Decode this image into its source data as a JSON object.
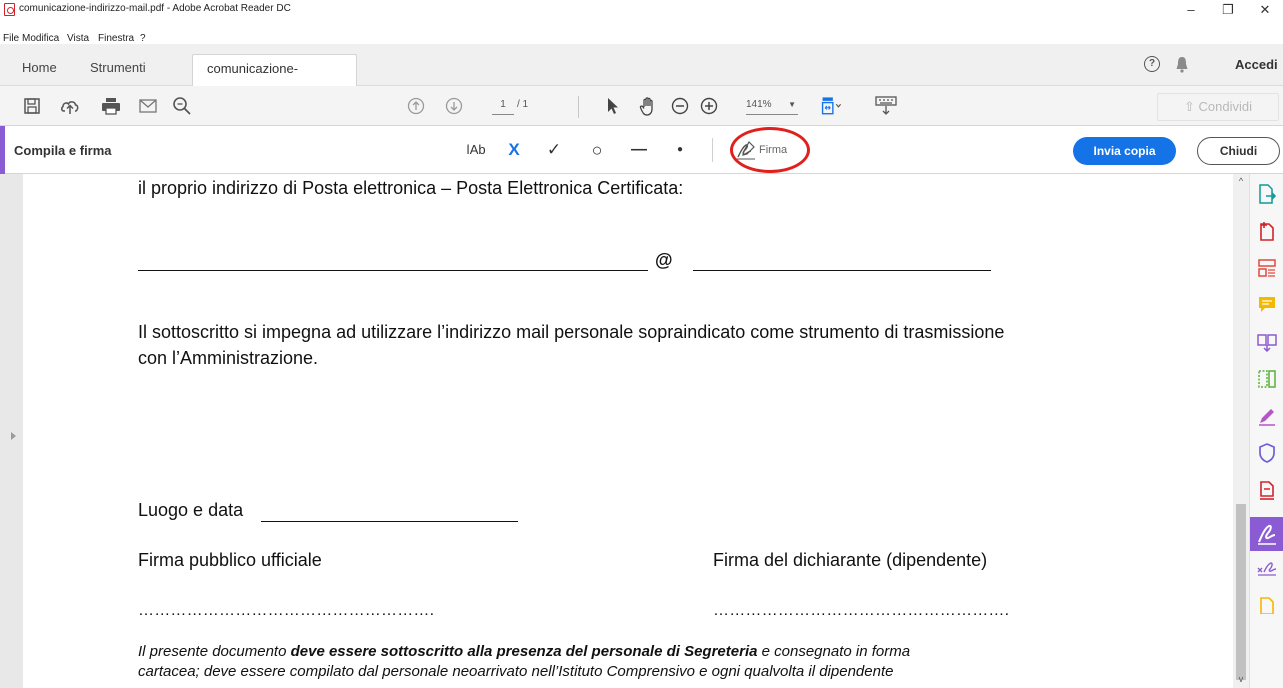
{
  "window": {
    "title": "comunicazione-indirizzo-mail.pdf - Adobe Acrobat Reader DC",
    "controls": {
      "minimize": "–",
      "restore": "❐",
      "close": "✕"
    }
  },
  "menu": [
    "File",
    "Modifica",
    "Vista",
    "Finestra",
    "?"
  ],
  "tabs": {
    "home": "Home",
    "tools": "Strumenti",
    "document": "comunicazione-indi...",
    "document_close": "×",
    "help_icon": "?",
    "signin": "Accedi"
  },
  "toolbar": {
    "page_current": "1",
    "page_total": "/ 1",
    "zoom": "141%",
    "zoom_dropdown": "▼",
    "share": "Condividi",
    "icons": [
      "save-icon",
      "upload-cloud-icon",
      "print-icon",
      "email-icon",
      "search-icon",
      "page-up-icon",
      "page-down-icon",
      "select-cursor-icon",
      "hand-icon",
      "zoom-out-icon",
      "zoom-in-icon",
      "fit-page-icon",
      "keyboard-icon"
    ]
  },
  "fill_sign": {
    "label": "Compila e firma",
    "text_tool": "ǀAb",
    "cross_tool": "X",
    "check_tool": "✓",
    "circle_tool": "○",
    "line_tool": "—",
    "dot_tool": "●",
    "sign_label": "Firma",
    "send_copy": "Invia copia",
    "close": "Chiudi"
  },
  "document": {
    "line1": "il proprio indirizzo di Posta elettronica – Posta Elettronica Certificata:",
    "at_sign": "@",
    "para1_l1": "Il sottoscritto si impegna ad utilizzare l’indirizzo mail personale sopraindicato come strumento di trasmissione",
    "para1_l2": "con  l’Amministrazione.",
    "place_date": "Luogo e data",
    "sig_official": "Firma pubblico ufficiale",
    "sig_declarant": "Firma del dichiarante (dipendente)",
    "dots_left": "……………………………………………….",
    "dots_right": "……………………………………………….",
    "note_l1_a": "Il presente documento ",
    "note_l1_b": "deve essere sottoscritto alla presenza del personale di Segreteria",
    "note_l1_c": " e consegnato in forma",
    "note_l2": "cartacea; deve essere compilato dal personale neoarrivato nell’Istituto Comprensivo e ogni qualvolta il dipendente"
  },
  "scrollbar": {
    "up": "^",
    "down": "v"
  },
  "colors": {
    "accent_purple": "#8b5bd3",
    "primary_blue": "#1473e6",
    "highlight_red": "#e0201c"
  }
}
